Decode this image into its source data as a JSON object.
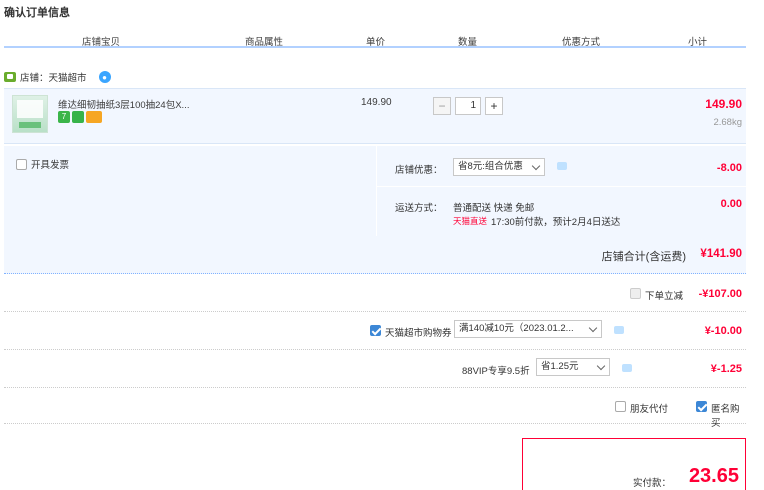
{
  "page_title": "确认订单信息",
  "columns": [
    "店铺宝贝",
    "商品属性",
    "单价",
    "数量",
    "优惠方式",
    "小计"
  ],
  "shop": {
    "label": "店铺：天猫超市"
  },
  "item": {
    "name": "维达细韧抽纸3层100抽24包X...",
    "unit_price": "149.90",
    "quantity": "1",
    "qty_minus": "−",
    "qty_plus": "+",
    "subtotal": "149.90",
    "weight": "2.68kg"
  },
  "invoice": {
    "label": "开具发票"
  },
  "shop_promo": {
    "label": "店铺优惠：",
    "selected": "省8元:组合优惠",
    "amount": "-8.00"
  },
  "shipping": {
    "label": "运送方式：",
    "method": "普通配送 快递 免邮",
    "carrier": "天猫直送",
    "eta": "17:30前付款，预计2月4日送达",
    "amount": "0.00"
  },
  "shop_total": {
    "label": "店铺合计(含运费)",
    "amount": "¥141.90"
  },
  "direct_discount": {
    "label": "下单立减",
    "amount": "-¥107.00"
  },
  "coupon": {
    "label": "天猫超市购物券",
    "selected": "满140减10元（2023.01.2...",
    "amount": "¥-10.00"
  },
  "vip": {
    "label": "88VIP专享9.5折",
    "selected": "省1.25元",
    "amount": "¥-1.25"
  },
  "friend_pay": {
    "label": "朋友代付"
  },
  "anonymous": {
    "label": "匿名购买"
  },
  "final": {
    "label": "实付款：",
    "amount": "23.65"
  },
  "colors": {
    "accent": "#ff0036",
    "row_bg": "#f2f7ff",
    "checkbox": "#3c87d6"
  }
}
